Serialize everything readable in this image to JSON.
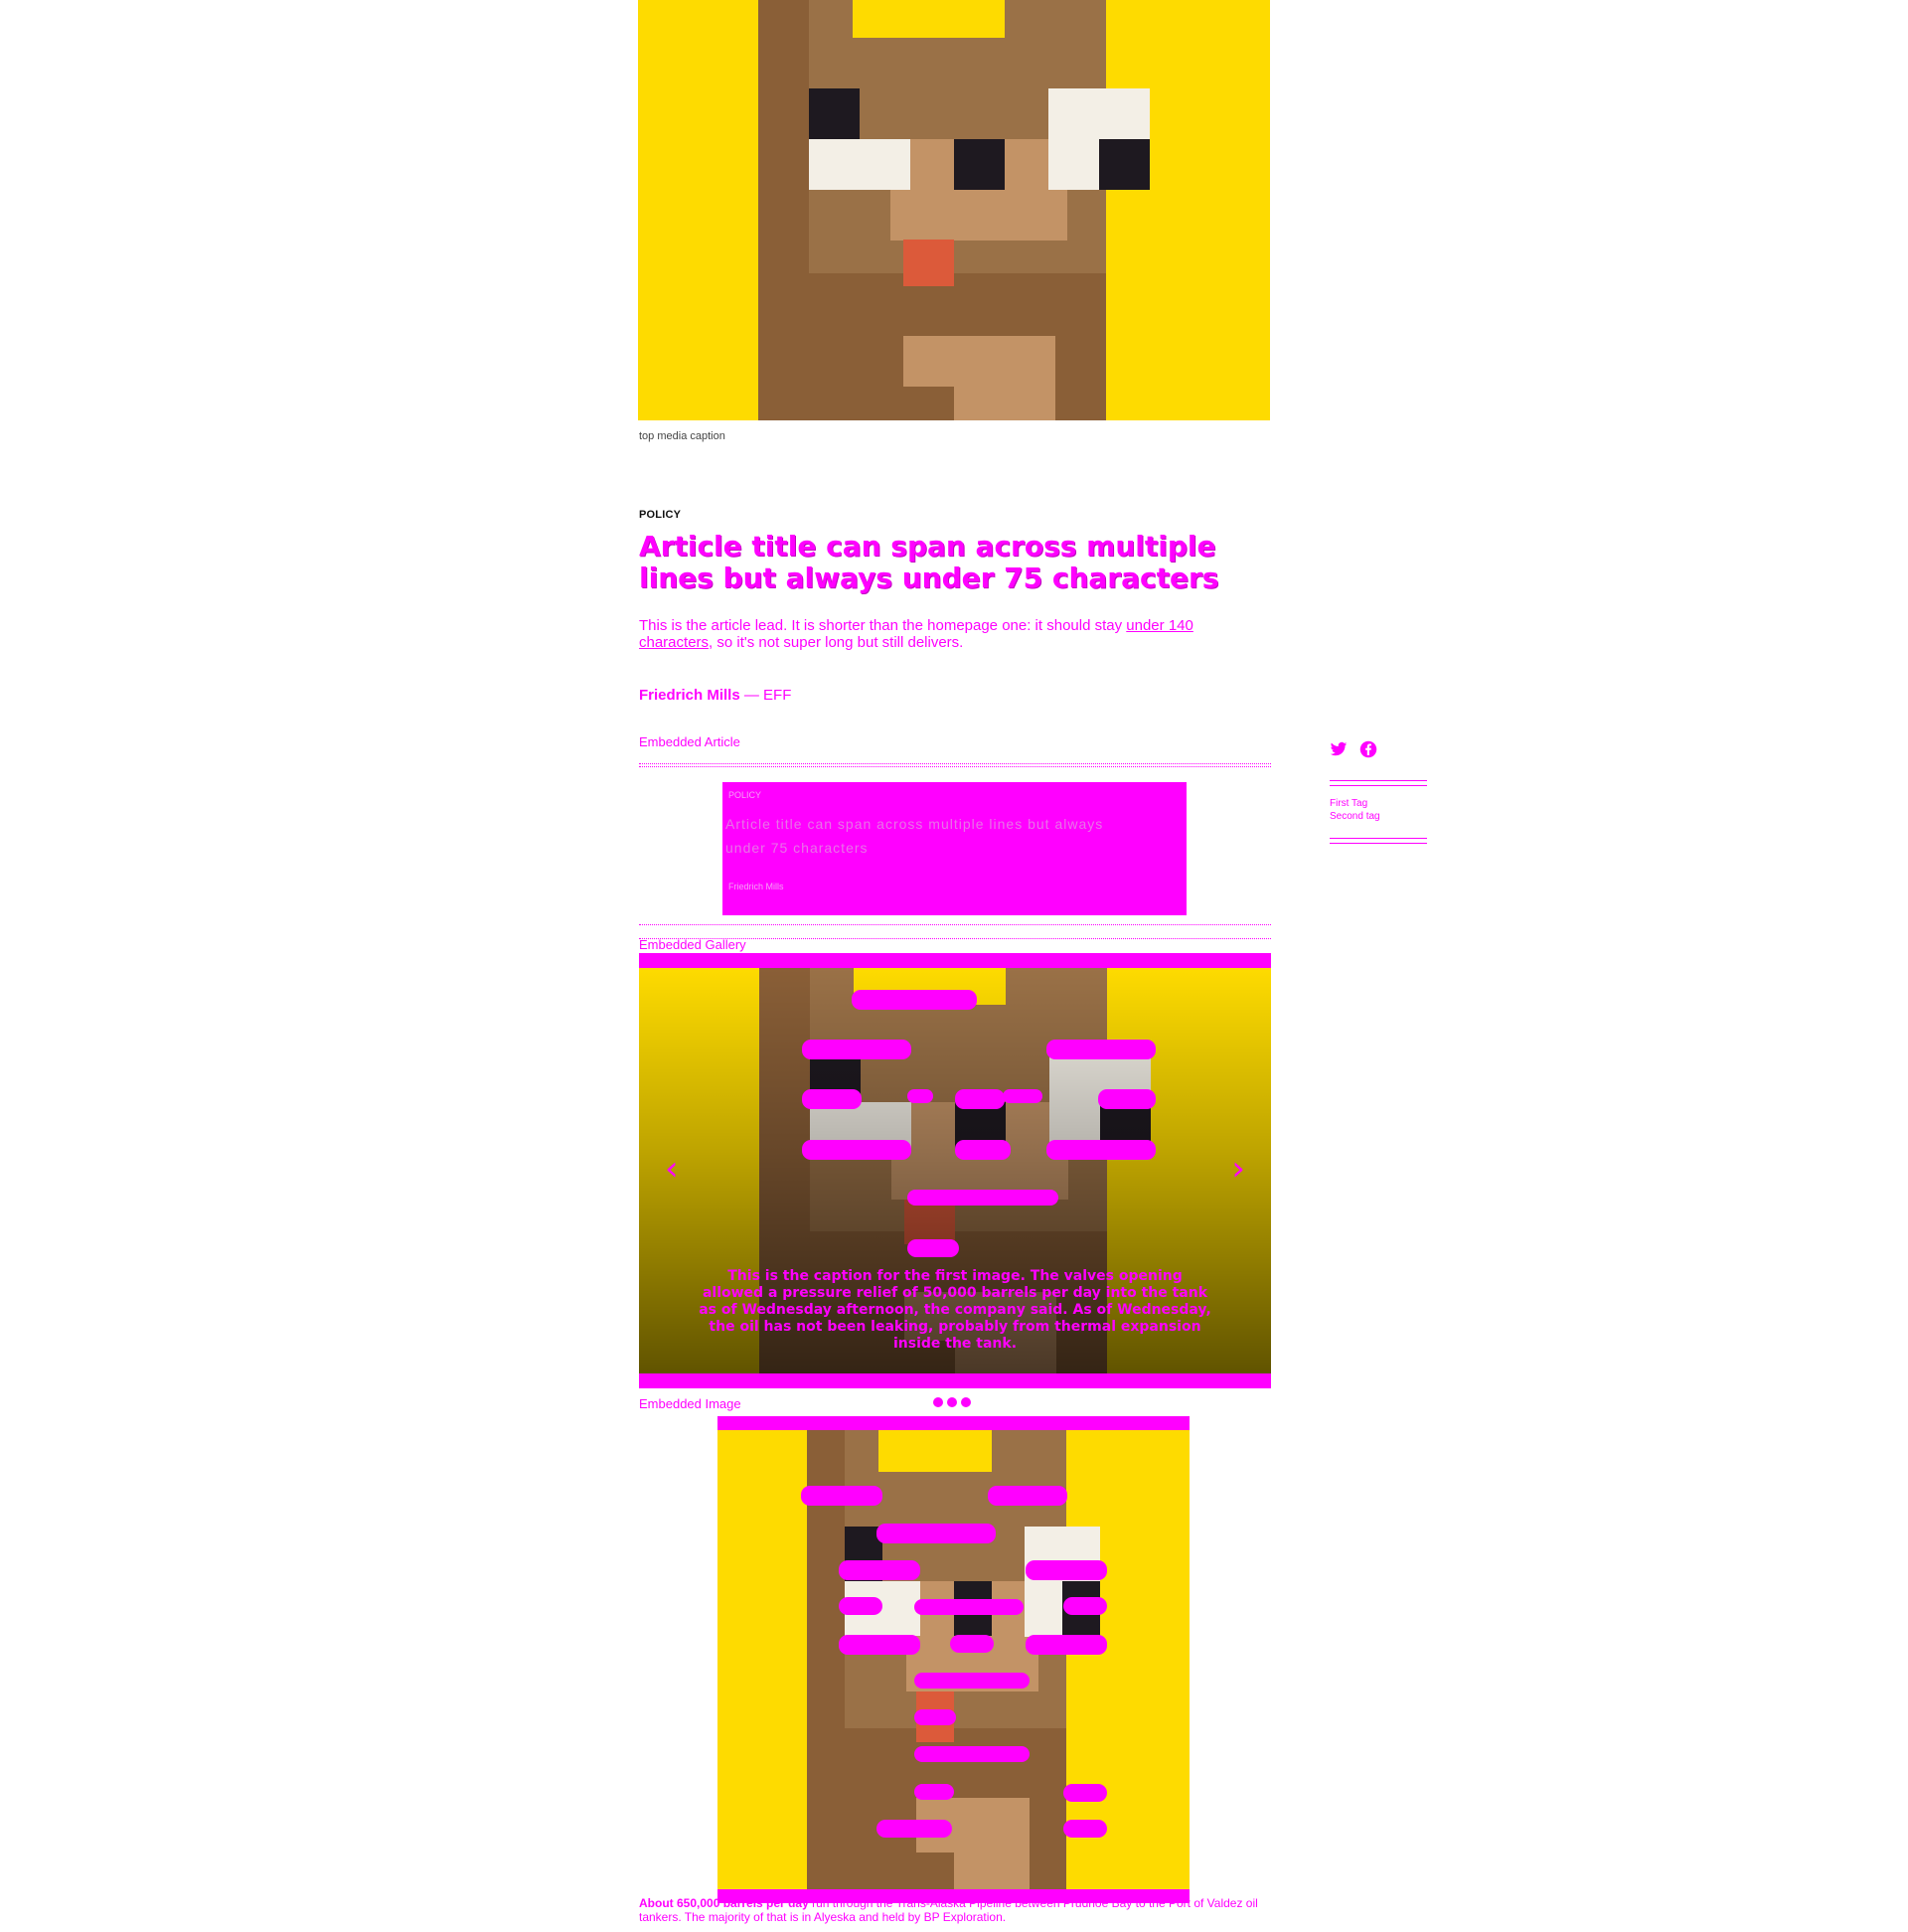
{
  "top_media": {
    "caption": "top media caption"
  },
  "article": {
    "kicker": "POLICY",
    "title": "Article title can span across multiple lines but always under 75 characters",
    "lead_main": "This is the article lead. It is shorter than the homepage one: it should stay",
    "lead_link": "under 140 characters",
    "lead_end": ", so it's not super long but still delivers.",
    "author": "Friedrich Mills",
    "separator": "—",
    "publication": "EFF"
  },
  "embedded_article": {
    "label": "Embedded Article",
    "card_kicker": "POLICY",
    "card_title": "Article title can span across multiple lines but always under 75 characters",
    "card_meta": "Friedrich Mills"
  },
  "gallery": {
    "label": "Embedded Gallery",
    "caption": "This is the caption for the first image. The valves opening allowed a pressure relief of 50,000 barrels per day into the tank as of Wednesday afternoon, the company said. As of Wednesday, the oil has not been leaking, probably from thermal expansion inside the tank.",
    "prev_label": "‹",
    "next_label": "›",
    "current_slide": 1,
    "total_slides": 3
  },
  "embedded_image": {
    "label": "Embedded Image"
  },
  "body": {
    "strong": "About 650,000 barrels per day",
    "rest": " run through the Trans-Alaska Pipeline between Prudhoe Bay to the Port of Valdez oil tankers. The majority of that is in Alyeska and held by BP Exploration."
  },
  "sidebar": {
    "share_icons": [
      "twitter-icon",
      "facebook-icon"
    ],
    "tags": [
      "First Tag",
      "Second tag"
    ]
  },
  "colors": {
    "accent": "#ff00ff",
    "sprite_bg": "#fedb00",
    "sprite_brown": "#936c43"
  }
}
